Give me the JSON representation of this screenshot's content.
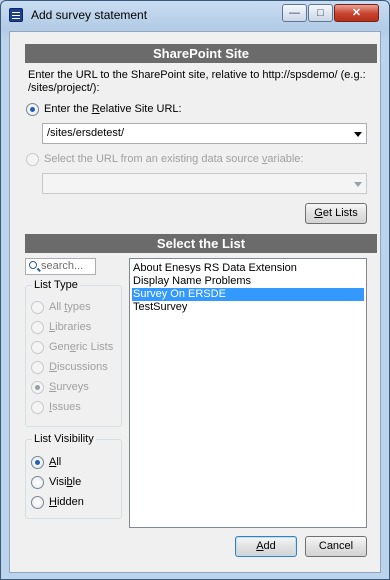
{
  "window": {
    "title": "Add survey statement"
  },
  "sharepoint": {
    "header": "SharePoint Site",
    "instruction_line1": "Enter the URL to the SharePoint site, relative to http://spsdemo/ (e.g.:",
    "instruction_line2": "/sites/project/):",
    "relative_option": {
      "prefix": "Enter the ",
      "accel": "R",
      "suffix": "elative Site URL:"
    },
    "relative_url_value": "/sites/ersdetest/",
    "datasource_option": {
      "prefix": "Select the URL from an existing data source ",
      "accel": "v",
      "suffix": "ariable:"
    },
    "datasource_value": "",
    "get_lists_button": {
      "accel": "G",
      "rest": "et Lists"
    }
  },
  "list_section": {
    "header": "Select the List",
    "search_placeholder": "search...",
    "list_type": {
      "legend": "List Type",
      "options": [
        {
          "prefix": "All ",
          "accel": "t",
          "suffix": "ypes"
        },
        {
          "prefix": "",
          "accel": "L",
          "suffix": "ibraries"
        },
        {
          "prefix": "Gen",
          "accel": "e",
          "suffix": "ric Lists"
        },
        {
          "prefix": "",
          "accel": "D",
          "suffix": "iscussions"
        },
        {
          "prefix": "",
          "accel": "S",
          "suffix": "urveys"
        },
        {
          "prefix": "",
          "accel": "I",
          "suffix": "ssues"
        }
      ],
      "selected": "Surveys"
    },
    "list_visibility": {
      "legend": "List Visibility",
      "options": [
        {
          "prefix": "",
          "accel": "A",
          "suffix": "ll"
        },
        {
          "prefix": "Visi",
          "accel": "b",
          "suffix": "le"
        },
        {
          "prefix": "",
          "accel": "H",
          "suffix": "idden"
        }
      ],
      "selected": "All"
    },
    "lists": [
      "About Enesys RS Data Extension",
      "Display Name Problems",
      "Survey On ERSDE",
      "TestSurvey"
    ],
    "selected_list": "Survey On ERSDE"
  },
  "buttons": {
    "add": {
      "accel": "A",
      "rest": "dd"
    },
    "cancel": "Cancel"
  },
  "title_controls": {
    "minimize": "—",
    "maximize": "□",
    "close": "✕"
  }
}
